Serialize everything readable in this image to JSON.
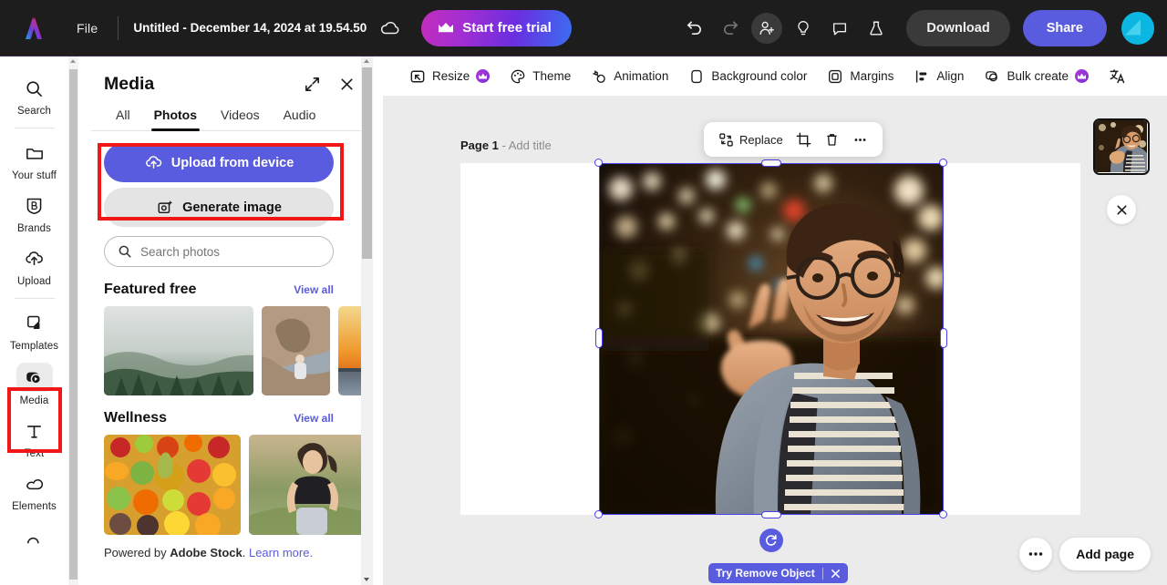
{
  "topbar": {
    "logo_icon": "adobe-express-logo",
    "file_menu": "File",
    "doc_title": "Untitled - December 14, 2024 at 19.54.50",
    "cloud_icon": "cloud-sync-icon",
    "trial_button": "Start free trial",
    "trial_icon": "crown-icon",
    "undo_icon": "undo-icon",
    "redo_icon": "redo-icon",
    "invite_icon": "add-user-icon",
    "ideas_icon": "lightbulb-icon",
    "comment_icon": "comment-icon",
    "labs_icon": "beaker-icon",
    "download_button": "Download",
    "share_button": "Share",
    "avatar_icon": "user-avatar",
    "accent_purple": "#5a5ce0",
    "bg": "#1d1d1d"
  },
  "rail": {
    "items": [
      {
        "label": "Search",
        "icon": "search-icon",
        "selected": false
      },
      {
        "label": "Your stuff",
        "icon": "folder-icon",
        "selected": false
      },
      {
        "label": "Brands",
        "icon": "brand-shield-icon",
        "selected": false
      },
      {
        "label": "Upload",
        "icon": "upload-cloud-icon",
        "selected": false
      },
      {
        "label": "Templates",
        "icon": "templates-icon",
        "selected": false
      },
      {
        "label": "Media",
        "icon": "media-icon",
        "selected": true
      },
      {
        "label": "Text",
        "icon": "text-icon",
        "selected": false
      },
      {
        "label": "Elements",
        "icon": "elements-icon",
        "selected": false
      }
    ]
  },
  "panel": {
    "title": "Media",
    "expand_icon": "expand-diagonal-icon",
    "close_icon": "close-icon",
    "tabs": [
      {
        "label": "All",
        "active": false
      },
      {
        "label": "Photos",
        "active": true
      },
      {
        "label": "Videos",
        "active": false
      },
      {
        "label": "Audio",
        "active": false
      }
    ],
    "upload_button": "Upload from device",
    "upload_icon": "upload-cloud-icon",
    "generate_button": "Generate image",
    "generate_icon": "generate-sparkle-icon",
    "search_placeholder": "Search photos",
    "search_value": "",
    "search_icon": "search-icon",
    "sections": [
      {
        "title": "Featured free",
        "view_all": "View all",
        "thumbs": [
          "misty-forest-photo",
          "woman-on-rocks-photo",
          "orange-sunset-photo"
        ]
      },
      {
        "title": "Wellness",
        "view_all": "View all",
        "thumbs": [
          "fruits-vegetables-photo",
          "woman-jogging-photo"
        ]
      }
    ],
    "powered_prefix": "Powered by ",
    "powered_brand": "Adobe Stock",
    "powered_mid": ". ",
    "powered_link": "Learn more."
  },
  "context_toolbar": {
    "items": [
      {
        "label": "Resize",
        "icon": "resize-icon",
        "premium": true
      },
      {
        "label": "Theme",
        "icon": "palette-icon",
        "premium": false
      },
      {
        "label": "Animation",
        "icon": "animation-icon",
        "premium": false
      },
      {
        "label": "Background color",
        "icon": "background-color-icon",
        "premium": false
      },
      {
        "label": "Margins",
        "icon": "margins-icon",
        "premium": false
      },
      {
        "label": "Align",
        "icon": "align-icon",
        "premium": false
      },
      {
        "label": "Bulk create",
        "icon": "bulk-create-icon",
        "premium": true
      },
      {
        "label": "",
        "icon": "translate-icon",
        "premium": false
      }
    ]
  },
  "canvas": {
    "page_label_bold": "Page 1",
    "page_label_rest": " - Add title",
    "float_toolbar": {
      "replace_label": "Replace",
      "replace_icon": "replace-icon",
      "crop_icon": "crop-icon",
      "delete_icon": "trash-icon",
      "more_icon": "more-horizontal-icon"
    },
    "rotate_icon": "rotate-icon",
    "selection_color": "#4a3ee8",
    "remove_badge": {
      "label": "Try Remove Object",
      "close_icon": "close-icon",
      "color": "#5a5ce0"
    },
    "more_pages_icon": "more-horizontal-icon",
    "add_page_button": "Add page",
    "thumbnail": "selected-photo-thumbnail",
    "thumbnail_close_icon": "close-icon",
    "selected_image": "man-with-glasses-peace-sign-night-bokeh"
  },
  "highlights": {
    "color": "#f21717",
    "regions": [
      "media-rail-item",
      "upload-from-device-button"
    ]
  }
}
